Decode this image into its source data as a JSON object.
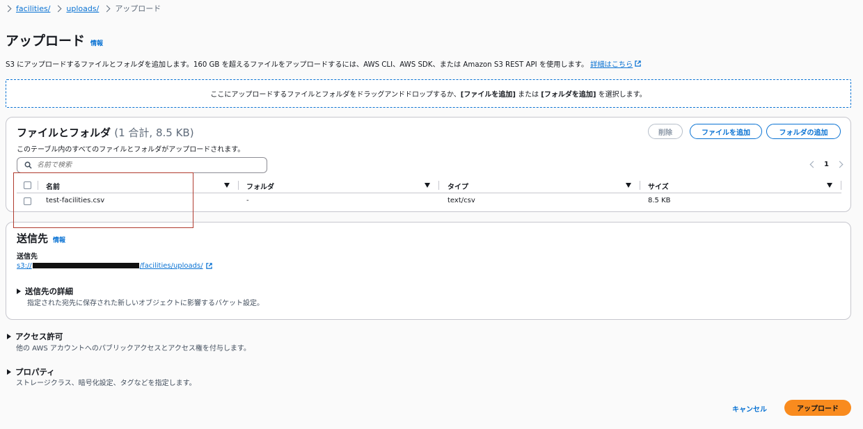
{
  "breadcrumb": {
    "items": [
      "facilities/",
      "uploads/"
    ],
    "current": "アップロード"
  },
  "page": {
    "title": "アップロード",
    "info_link": "情報",
    "description": "S3 にアップロードするファイルとフォルダを追加します。160 GB を超えるファイルをアップロードするには、AWS CLI、AWS SDK、または Amazon S3 REST API を使用します。",
    "learn_more": "詳細はこちら"
  },
  "dropzone": {
    "prefix": "ここにアップロードするファイルとフォルダをドラッグアンドドロップするか、",
    "add_files": "[ファイルを追加]",
    "middle": " または ",
    "add_folder": "[フォルダを追加]",
    "suffix": " を選択します。"
  },
  "files_panel": {
    "title": "ファイルとフォルダ",
    "count": "(1 合計, 8.5 KB)",
    "subtitle": "このテーブル内のすべてのファイルとフォルダがアップロードされます。",
    "delete_button": "削除",
    "add_files_button": "ファイルを追加",
    "add_folder_button": "フォルダの追加",
    "search_placeholder": "名前で検索",
    "page_number": "1",
    "columns": [
      "名前",
      "フォルダ",
      "タイプ",
      "サイズ"
    ],
    "rows": [
      {
        "name": "test-facilities.csv",
        "folder": "-",
        "type": "text/csv",
        "size": "8.5 KB"
      }
    ]
  },
  "destination": {
    "title": "送信先",
    "info_link": "情報",
    "label": "送信先",
    "url_prefix": "s3://",
    "url_suffix": "/facilities/uploads/",
    "details_title": "送信先の詳細",
    "details_desc": "指定された宛先に保存された新しいオブジェクトに影響するバケット設定。"
  },
  "permissions": {
    "title": "アクセス許可",
    "desc": "他の AWS アカウントへのパブリックアクセスとアクセス権を付与します。"
  },
  "properties": {
    "title": "プロパティ",
    "desc": "ストレージクラス、暗号化設定、タグなどを指定します。"
  },
  "footer": {
    "cancel": "キャンセル",
    "upload": "アップロード"
  },
  "colors": {
    "link": "#0972d3",
    "primary_button": "#f98b1e",
    "highlight_box": "#b03a2e"
  }
}
